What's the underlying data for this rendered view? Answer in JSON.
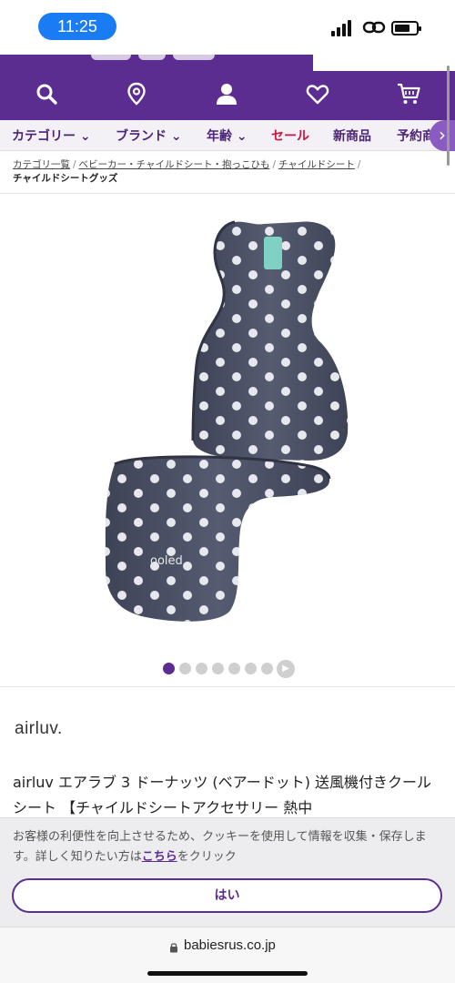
{
  "status_bar": {
    "time": "11:25"
  },
  "nav": {
    "icons": [
      "search-icon",
      "location-icon",
      "account-icon",
      "favorites-icon",
      "cart-icon"
    ]
  },
  "categories": [
    {
      "label": "カテゴリー ⌄"
    },
    {
      "label": "ブランド ⌄"
    },
    {
      "label": "年齢 ⌄"
    },
    {
      "label": "セール"
    },
    {
      "label": "新商品"
    },
    {
      "label": "予約商"
    }
  ],
  "breadcrumb": {
    "items": [
      "カテゴリ一覧",
      "ベビーカー・チャイルドシート・抱っこひも",
      "チャイルドシート"
    ],
    "current": "チャイルドシートグッズ",
    "separator": "/"
  },
  "product": {
    "brand": "airluv.",
    "title": "airluv エアラブ 3 ドーナッツ (ベアードット) 送風機付きクールシート 【チャイルドシートアクセサリー 熱中",
    "image_label": "ooled",
    "carousel": {
      "count": 7,
      "active_index": 0
    }
  },
  "cookie": {
    "text_before": "お客様の利便性を向上させるため、クッキーを使用して情報を収集・保存します。詳しく知りたい方は",
    "link": "こちら",
    "text_after": "をクリック",
    "accept_label": "はい"
  },
  "browser": {
    "url": "babiesrus.co.jp"
  },
  "colors": {
    "brand_purple": "#5c2d91",
    "sale_red": "#d1123f",
    "seat_navy": "#4a4f63"
  }
}
